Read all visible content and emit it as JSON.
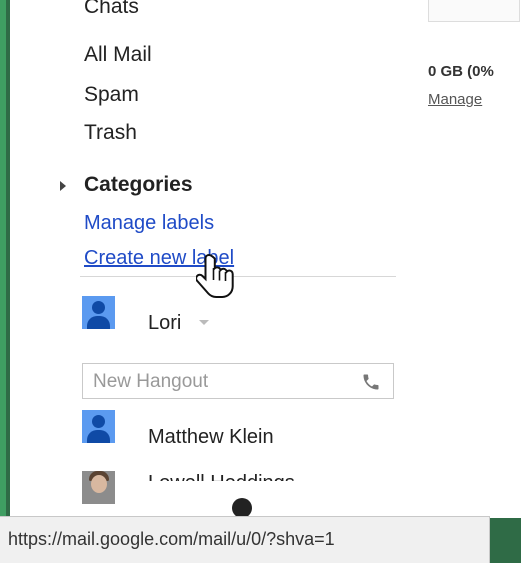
{
  "nav": {
    "chats": "Chats",
    "all_mail": "All Mail",
    "spam": "Spam",
    "trash": "Trash",
    "categories": "Categories",
    "manage_labels": "Manage labels",
    "create_label": "Create new label"
  },
  "hangouts": {
    "me": "Lori",
    "search_placeholder": "New Hangout",
    "contacts": [
      {
        "name": "Matthew Klein"
      },
      {
        "name": "Lowell Heddings"
      }
    ]
  },
  "storage": {
    "usage": "0 GB (0%",
    "manage_link": "Manage"
  },
  "status_bar": {
    "url": "https://mail.google.com/mail/u/0/?shva=1"
  },
  "colors": {
    "link": "#1f4bc7",
    "avatar": "#5b9af0",
    "frame_green": "#3f9e62"
  }
}
